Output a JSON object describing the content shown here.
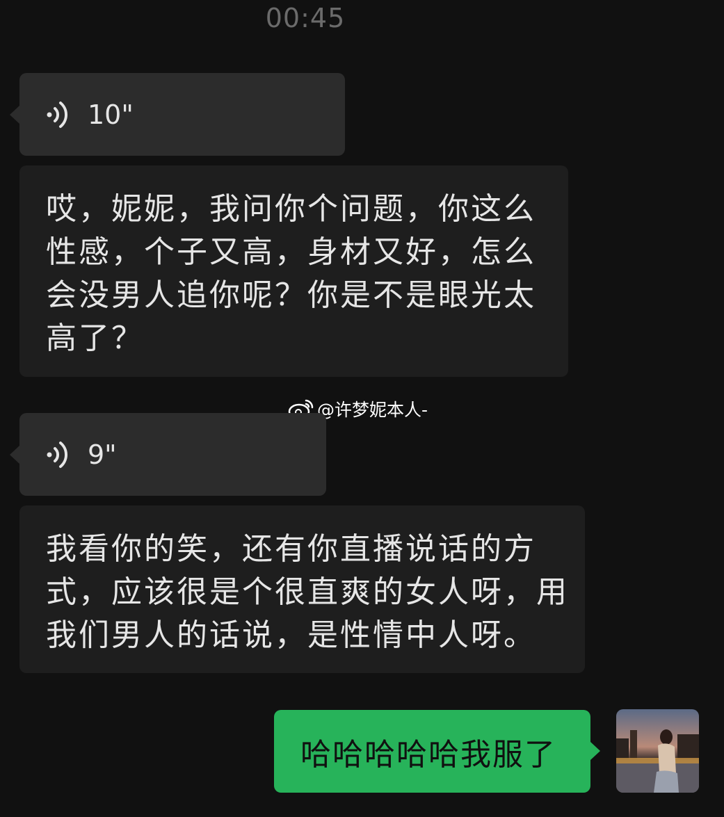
{
  "timestamp": "00:45",
  "messages": [
    {
      "type": "voice",
      "duration": "10\""
    },
    {
      "type": "transcript",
      "text": "哎，妮妮，我问你个问题，你这么性感，个子又高，身材又好，怎么会没男人追你呢？你是不是眼光太高了？"
    },
    {
      "type": "voice",
      "duration": "9\""
    },
    {
      "type": "transcript",
      "text": "我看你的笑，还有你直播说话的方式，应该很是个很直爽的女人呀，用我们男人的话说，是性情中人呀。"
    },
    {
      "type": "sent",
      "text": "哈哈哈哈哈我服了"
    }
  ],
  "watermark": "@许梦妮本人-",
  "icons": {
    "voice": "voice-wave-icon",
    "watermark": "weibo-logo-icon",
    "avatar": "user-avatar"
  },
  "colors": {
    "background": "#111111",
    "incoming_bubble": "#2c2c2c",
    "sent_bubble": "#27b35a"
  }
}
